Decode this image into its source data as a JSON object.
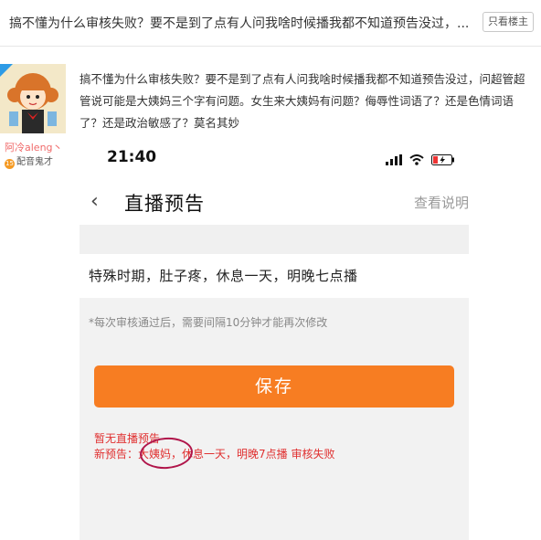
{
  "thread": {
    "title": "搞不懂为什么审核失败？要不是到了点有人问我啥时候播我都不知道预告没过，...",
    "only_op_label": "只看楼主"
  },
  "author": {
    "username": "阿冷aleng丶",
    "badge_label": "配音鬼才",
    "badge_icon_text": "15"
  },
  "post": {
    "body": "搞不懂为什么审核失败？要不是到了点有人问我啥时候播我都不知道预告没过，问超管超管说可能是大姨妈三个字有问题。女生来大姨妈有问题？侮辱性词语了？还是色情词语了？还是政治敏感了？莫名其妙"
  },
  "phone": {
    "time": "21:40",
    "back_icon": "‹",
    "title": "直播预告",
    "help_label": "查看说明",
    "preview_text": "特殊时期，肚子疼，休息一天，明晚七点播",
    "note": "*每次审核通过后，需要间隔10分钟才能再次修改",
    "save_label": "保存",
    "status_line1": "暂无直播预告",
    "status_line2": "新预告：大姨妈，休息一天，明晚7点播 审核失败"
  },
  "colors": {
    "accent_orange": "#f77d22",
    "error_red": "#e03030",
    "username_pink": "#f06a6a",
    "circle_mark": "#b0154a"
  }
}
